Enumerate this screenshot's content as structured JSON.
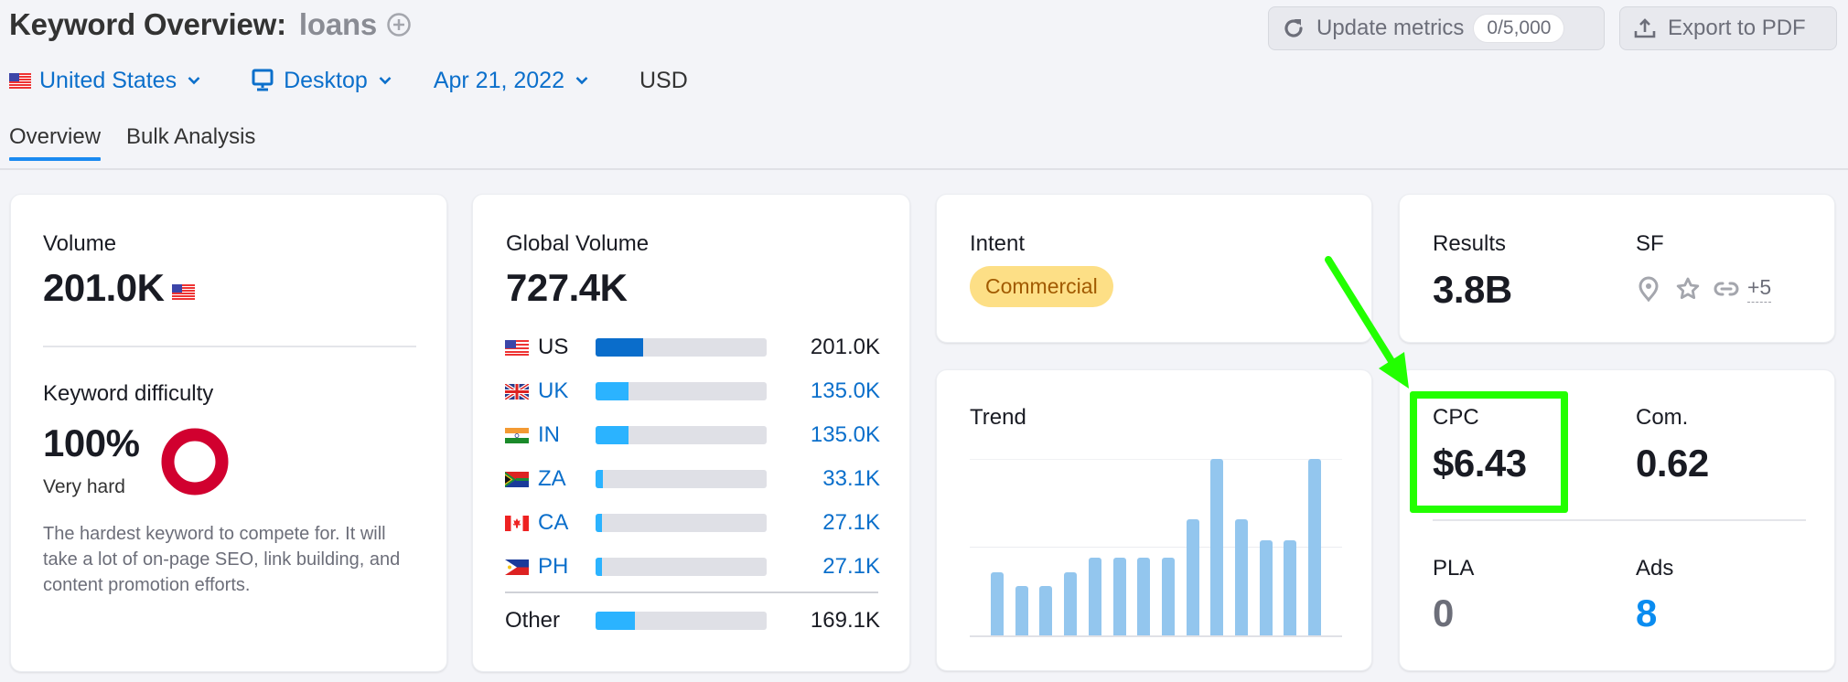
{
  "header": {
    "title": "Keyword Overview:",
    "keyword": "loans",
    "update_button": {
      "label": "Update metrics",
      "badge": "0/5,000",
      "icon": "refresh-icon"
    },
    "export_button": {
      "label": "Export to PDF",
      "icon": "upload-icon"
    }
  },
  "filters": {
    "country": "United States",
    "device": "Desktop",
    "date": "Apr 21, 2022",
    "currency": "USD"
  },
  "tabs": [
    {
      "label": "Overview",
      "active": true
    },
    {
      "label": "Bulk Analysis",
      "active": false
    }
  ],
  "volume_card": {
    "label": "Volume",
    "value": "201.0K",
    "flag": "us-flag-icon",
    "kd_label": "Keyword difficulty",
    "kd_value": "100%",
    "kd_percent": 100,
    "kd_level": "Very hard",
    "kd_color": "#d1002f",
    "kd_description": "The hardest keyword to compete for. It will take a lot of on-page SEO, link building, and content promotion efforts."
  },
  "global_volume_card": {
    "label": "Global Volume",
    "value": "727.4K",
    "countries": [
      {
        "code": "US",
        "value": "201.0K",
        "share": 0.28,
        "link": false
      },
      {
        "code": "UK",
        "value": "135.0K",
        "share": 0.19,
        "link": true
      },
      {
        "code": "IN",
        "value": "135.0K",
        "share": 0.19,
        "link": true
      },
      {
        "code": "ZA",
        "value": "33.1K",
        "share": 0.045,
        "link": true
      },
      {
        "code": "CA",
        "value": "27.1K",
        "share": 0.037,
        "link": true
      },
      {
        "code": "PH",
        "value": "27.1K",
        "share": 0.037,
        "link": true
      }
    ],
    "other": {
      "label": "Other",
      "value": "169.1K",
      "share": 0.23
    }
  },
  "intent_card": {
    "label": "Intent",
    "value": "Commercial"
  },
  "trend_card": {
    "label": "Trend",
    "chart_data": {
      "type": "bar",
      "title": "Trend",
      "normalized": true,
      "values": [
        0.36,
        0.28,
        0.28,
        0.36,
        0.44,
        0.44,
        0.44,
        0.44,
        0.66,
        1.0,
        0.66,
        0.54,
        0.54,
        1.0
      ],
      "ylim": [
        0,
        1
      ],
      "grid": true
    }
  },
  "results_card": {
    "results_label": "Results",
    "results_value": "3.8B",
    "sf_label": "SF",
    "sf_icons": [
      "location-pin-icon",
      "star-icon",
      "link-icon"
    ],
    "sf_more": "+5"
  },
  "cpc_card": {
    "cpc_label": "CPC",
    "cpc_value": "$6.43",
    "com_label": "Com.",
    "com_value": "0.62",
    "pla_label": "PLA",
    "pla_value": "0",
    "ads_label": "Ads",
    "ads_value": "8"
  },
  "annotation": {
    "color": "#22ff00",
    "target": "CPC"
  }
}
